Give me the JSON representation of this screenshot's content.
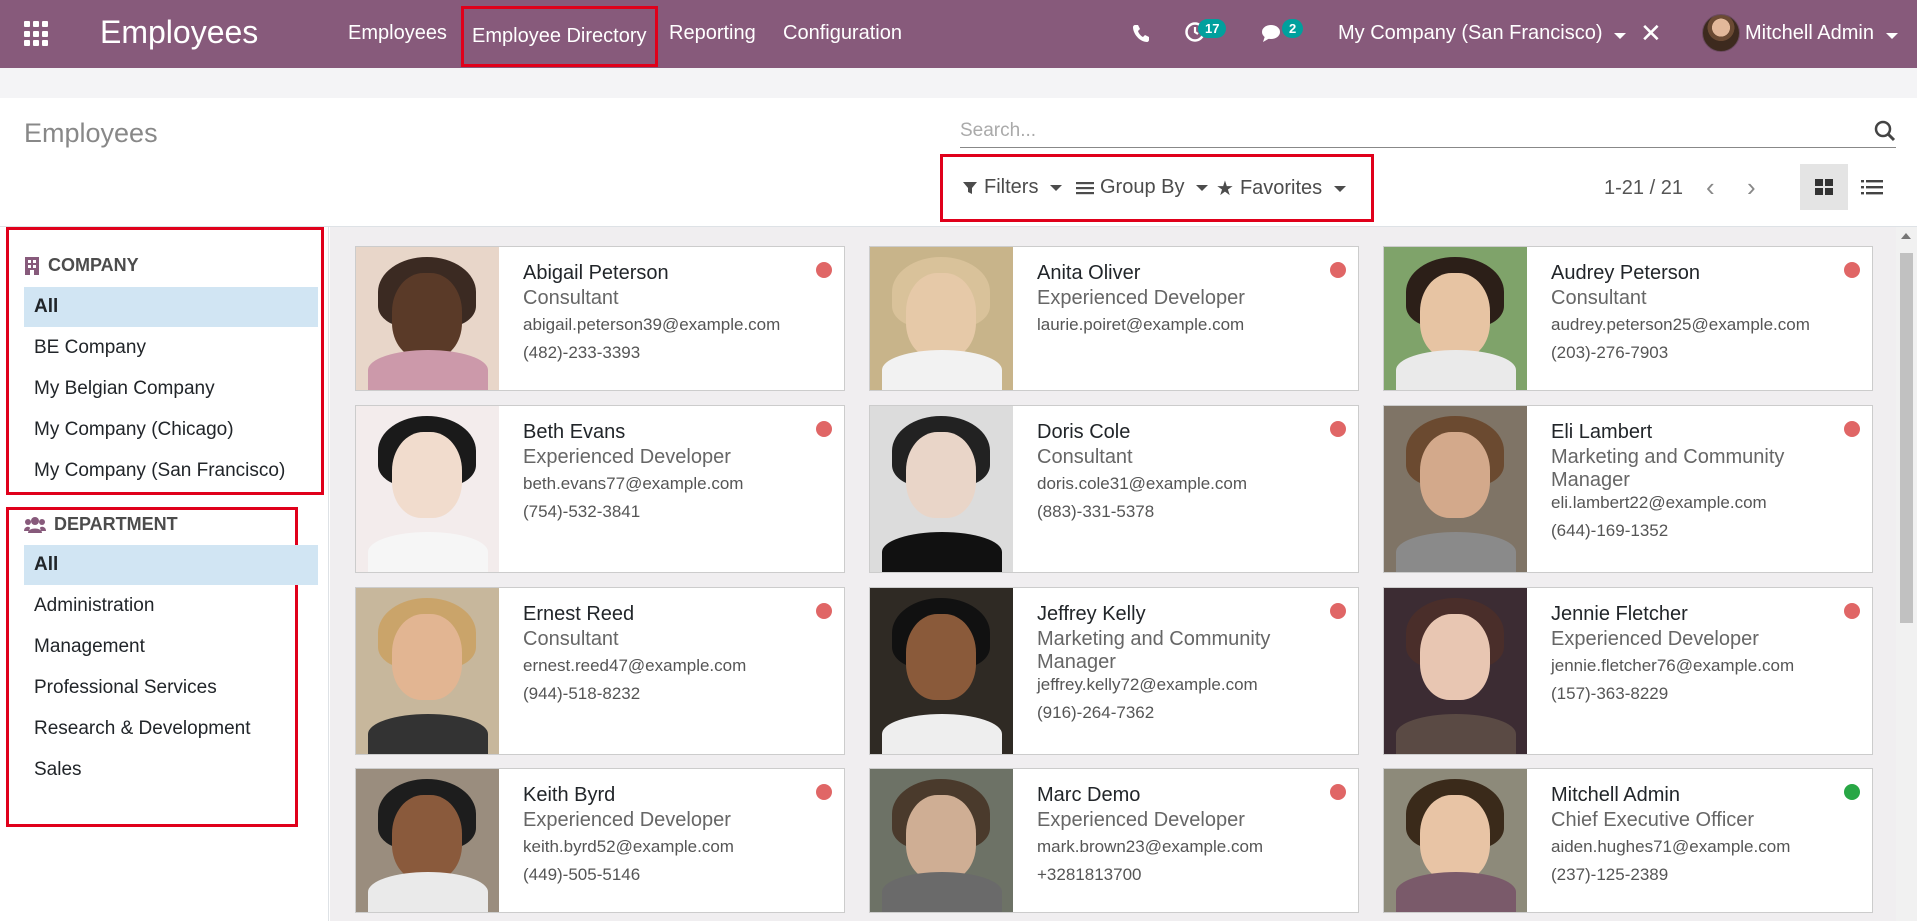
{
  "navbar": {
    "app_title": "Employees",
    "menu": [
      "Employees",
      "Employee Directory",
      "Reporting",
      "Configuration"
    ],
    "activity_count": "17",
    "messages_count": "2",
    "company": "My Company (San Francisco)",
    "user": "Mitchell Admin"
  },
  "control_panel": {
    "title": "Employees",
    "search_placeholder": "Search...",
    "filters_label": "Filters",
    "group_by_label": "Group By",
    "favorites_label": "Favorites",
    "pager": "1-21 / 21"
  },
  "sidebar": {
    "company_header": "COMPANY",
    "companies": [
      "All",
      "BE Company",
      "My Belgian Company",
      "My Company (Chicago)",
      "My Company (San Francisco)"
    ],
    "department_header": "DEPARTMENT",
    "departments": [
      "All",
      "Administration",
      "Management",
      "Professional Services",
      "Research & Development",
      "Sales"
    ]
  },
  "employees": [
    {
      "name": "Abigail Peterson",
      "job": "Consultant",
      "email": "abigail.peterson39@example.com",
      "phone": "(482)-233-3393",
      "status": "red"
    },
    {
      "name": "Anita Oliver",
      "job": "Experienced Developer",
      "email": "laurie.poiret@example.com",
      "phone": "",
      "status": "red"
    },
    {
      "name": "Audrey Peterson",
      "job": "Consultant",
      "email": "audrey.peterson25@example.com",
      "phone": "(203)-276-7903",
      "status": "red"
    },
    {
      "name": "Beth Evans",
      "job": "Experienced Developer",
      "email": "beth.evans77@example.com",
      "phone": "(754)-532-3841",
      "status": "red"
    },
    {
      "name": "Doris Cole",
      "job": "Consultant",
      "email": "doris.cole31@example.com",
      "phone": "(883)-331-5378",
      "status": "red"
    },
    {
      "name": "Eli Lambert",
      "job": "Marketing and Community Manager",
      "email": "eli.lambert22@example.com",
      "phone": "(644)-169-1352",
      "status": "red"
    },
    {
      "name": "Ernest Reed",
      "job": "Consultant",
      "email": "ernest.reed47@example.com",
      "phone": "(944)-518-8232",
      "status": "red"
    },
    {
      "name": "Jeffrey Kelly",
      "job": "Marketing and Community Manager",
      "email": "jeffrey.kelly72@example.com",
      "phone": "(916)-264-7362",
      "status": "red"
    },
    {
      "name": "Jennie Fletcher",
      "job": "Experienced Developer",
      "email": "jennie.fletcher76@example.com",
      "phone": "(157)-363-8229",
      "status": "red"
    },
    {
      "name": "Keith Byrd",
      "job": "Experienced Developer",
      "email": "keith.byrd52@example.com",
      "phone": "(449)-505-5146",
      "status": "red"
    },
    {
      "name": "Marc Demo",
      "job": "Experienced Developer",
      "email": "mark.brown23@example.com",
      "phone": "+3281813700",
      "status": "red"
    },
    {
      "name": "Mitchell Admin",
      "job": "Chief Executive Officer",
      "email": "aiden.hughes71@example.com",
      "phone": "(237)-125-2389",
      "status": "green"
    }
  ],
  "colors": {
    "navbar": "#875a7b",
    "status_red": "#e06666",
    "status_green": "#28a745",
    "highlight": "#e0001b",
    "active_bg": "#d1e5f3"
  }
}
